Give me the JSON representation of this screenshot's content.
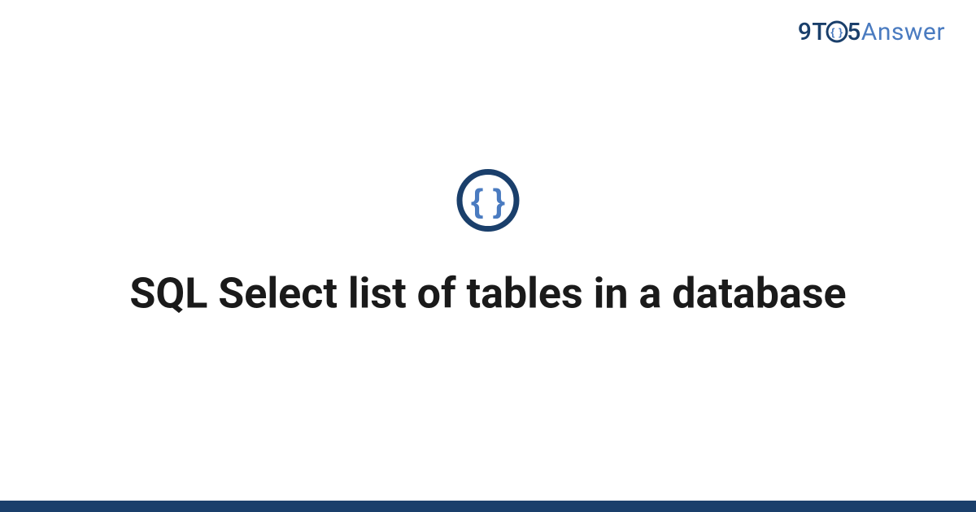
{
  "brand": {
    "nine": "9",
    "t": "T",
    "five": "5",
    "answer": "Answer"
  },
  "main": {
    "title": "SQL Select list of tables in a database"
  },
  "colors": {
    "dark_blue": "#1a3f6b",
    "light_blue": "#4a7bc0",
    "text": "#1a1a1a"
  }
}
